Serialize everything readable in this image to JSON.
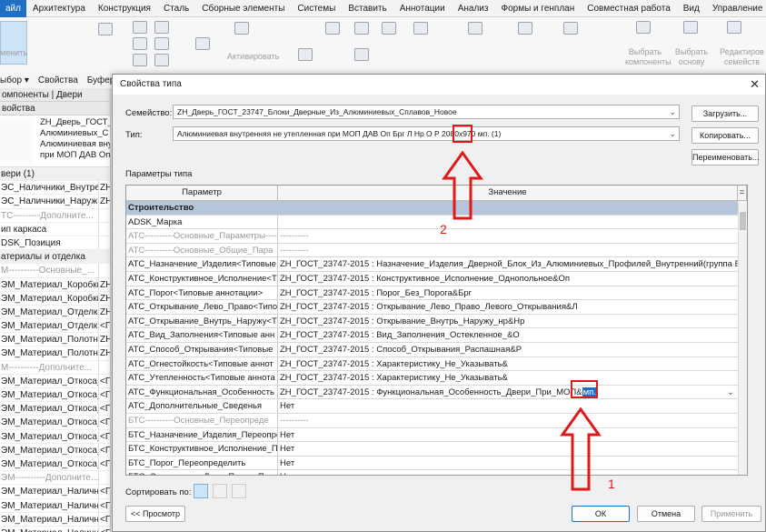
{
  "menubar": {
    "file": "айл",
    "items": [
      "Архитектура",
      "Конструкция",
      "Сталь",
      "Сборные элементы",
      "Системы",
      "Вставить",
      "Аннотации",
      "Анализ",
      "Формы и генплан",
      "Совместная работа",
      "Вид",
      "Управление",
      "Н"
    ]
  },
  "ribbon": {
    "labels": {
      "mod": "менить",
      "activate": "Активировать",
      "sel_comp": "Выбрать компоненты",
      "sel_base": "Выбрать основу",
      "edit_fam": "Редактиров семейств"
    }
  },
  "context": {
    "select": "ыбор ▾",
    "properties": "Свойства",
    "buffer": "Буфер"
  },
  "left_panel": {
    "breadcrumb": "омпоненты | Двери",
    "header": "войства",
    "preview_text": [
      "ZH_Дверь_ГОСТ_2",
      "Алюминиевых_С",
      "Алюминиевая внут",
      "при МОП ДАВ Оп"
    ],
    "rows": [
      {
        "k": "вери (1)",
        "v": "",
        "grp": true
      },
      {
        "k": "ЭС_Наличники_Внутре",
        "v": "ZH"
      },
      {
        "k": "ЭС_Наличники_Наруж",
        "v": "ZH"
      },
      {
        "k": "ТС---------Дополните...",
        "v": "",
        "gray": true
      },
      {
        "k": "ип каркаса",
        "v": ""
      },
      {
        "k": "DSK_Позиция",
        "v": ""
      },
      {
        "k": "атериалы и отделка",
        "v": "",
        "grp": true
      },
      {
        "k": "М----------Основные_...",
        "v": "",
        "gray": true
      },
      {
        "k": "ЭМ_Материал_Коробки",
        "v": "ZH"
      },
      {
        "k": "ЭМ_Материал_Коробки",
        "v": "ZH"
      },
      {
        "k": "ЭМ_Материал_Отделки",
        "v": "ZH"
      },
      {
        "k": "ЭМ_Материал_Отделки",
        "v": "<Г"
      },
      {
        "k": "ЭМ_Материал_Полотна",
        "v": "ZH"
      },
      {
        "k": "ЭМ_Материал_Полотна",
        "v": "ZH"
      },
      {
        "k": "М----------Дополните...",
        "v": "",
        "gray": true
      },
      {
        "k": "ЭМ_Материал_Откоса_...",
        "v": "<Г"
      },
      {
        "k": "ЭМ_Материал_Откоса_...",
        "v": "<Г"
      },
      {
        "k": "ЭМ_Материал_Откоса_...",
        "v": "<Г"
      },
      {
        "k": "ЭМ_Материал_Откоса_...",
        "v": "<Г"
      },
      {
        "k": "ЭМ_Материал_Откоса_...",
        "v": "<Г"
      },
      {
        "k": "ЭМ_Материал_Откоса_...",
        "v": "<Г"
      },
      {
        "k": "ЭМ_Материал_Откоса_...",
        "v": "<Г"
      },
      {
        "k": "ЭМ----------Дополните...",
        "v": "",
        "gray": true
      },
      {
        "k": "ЭМ_Материал_Наличн...",
        "v": "<Г"
      },
      {
        "k": "ЭМ_Материал_Наличн...",
        "v": "<Г"
      },
      {
        "k": "ЭМ_Материал_Наличн...",
        "v": "<Г"
      },
      {
        "k": "ЭМ_Материал_Наличн...",
        "v": "<Г"
      }
    ]
  },
  "dialog": {
    "title": "Свойства типа",
    "family_label": "Семейство:",
    "family_value": "ZH_Дверь_ГОСТ_23747_Блоки_Дверные_Из_Алюминиевых_Сплавов_Новое",
    "type_label": "Тип:",
    "type_value": "Алюминиевая внутренняя не утепленная при МОП ДАВ Оп Брг Л Нр О Р 2080х970 мп. (1)",
    "load_btn": "Загрузить...",
    "copy_btn": "Копировать...",
    "rename_btn": "Переименовать...",
    "params_label": "Параметры типа",
    "col_param": "Параметр",
    "col_value": "Значение",
    "rows": [
      {
        "p": "Строительство",
        "v": "",
        "cat": true
      },
      {
        "p": "ADSK_Марка",
        "v": ""
      },
      {
        "p": "АТС----------Основные_Параметры----",
        "v": "----------",
        "gray": true
      },
      {
        "p": "АТС----------Основные_Общие_Пара",
        "v": "----------",
        "gray": true
      },
      {
        "p": "АТС_Назначение_Изделия<Типовые",
        "v": "ZH_ГОСТ_23747-2015 : Назначение_Изделия_Дверной_Блок_Из_Алюминиевых_Профилей_Внутренний(группа Б)"
      },
      {
        "p": "АТС_Конструктивное_Исполнение<Т",
        "v": "ZH_ГОСТ_23747-2015 : Конструктивное_Исполнение_Однопольное&Оп"
      },
      {
        "p": "АТС_Порог<Типовые аннотации>",
        "v": "ZH_ГОСТ_23747-2015 : Порог_Без_Порога&Брг"
      },
      {
        "p": "АТС_Открывание_Лево_Право<Типо",
        "v": "ZH_ГОСТ_23747-2015 : Открывание_Лево_Право_Левого_Открывания&Л"
      },
      {
        "p": "АТС_Открывание_Внутрь_Наружу<Ти",
        "v": "ZH_ГОСТ_23747-2015 : Открывание_Внутрь_Наружу_нр&Нр"
      },
      {
        "p": "АТС_Вид_Заполнения<Типовые анн",
        "v": "ZH_ГОСТ_23747-2015 : Вид_Заполнения_Остекленное_&О"
      },
      {
        "p": "АТС_Способ_Открывания<Типовые",
        "v": "ZH_ГОСТ_23747-2015 : Способ_Открывания_Распашная&Р"
      },
      {
        "p": "АТС_Огнестойкость<Типовые аннот",
        "v": "ZH_ГОСТ_23747-2015 : Характеристику_Не_Указывать&"
      },
      {
        "p": "АТС_Утепленность<Типовые аннота",
        "v": "ZH_ГОСТ_23747-2015 : Характеристику_Не_Указывать&"
      },
      {
        "p": "АТС_Функциональная_Особенность",
        "v": "ZH_ГОСТ_23747-2015 : Функциональная_Особенность_Двери_При_МОП&",
        "hl": "мп.",
        "dd": true
      },
      {
        "p": "АТС_Дополнительные_Сведенья",
        "v": "Нет"
      },
      {
        "p": "БТС----------Основные_Переопреде",
        "v": "----------",
        "gray": true
      },
      {
        "p": "БТС_Назначение_Изделия_Переопре",
        "v": "Нет"
      },
      {
        "p": "БТС_Конструктивное_Исполнение_П",
        "v": "Нет"
      },
      {
        "p": "БТС_Порог_Переопределить",
        "v": "Нет"
      },
      {
        "p": "БТС_Открывание_Лево_Право_Пере",
        "v": "Нет"
      }
    ],
    "sort_label": "Сортировать по:",
    "preview_btn": "<< Просмотр",
    "ok_btn": "ОК",
    "cancel_btn": "Отмена",
    "apply_btn": "Применить"
  },
  "annotations": {
    "n1": "1",
    "n2": "2",
    "color": "#e0191b"
  }
}
